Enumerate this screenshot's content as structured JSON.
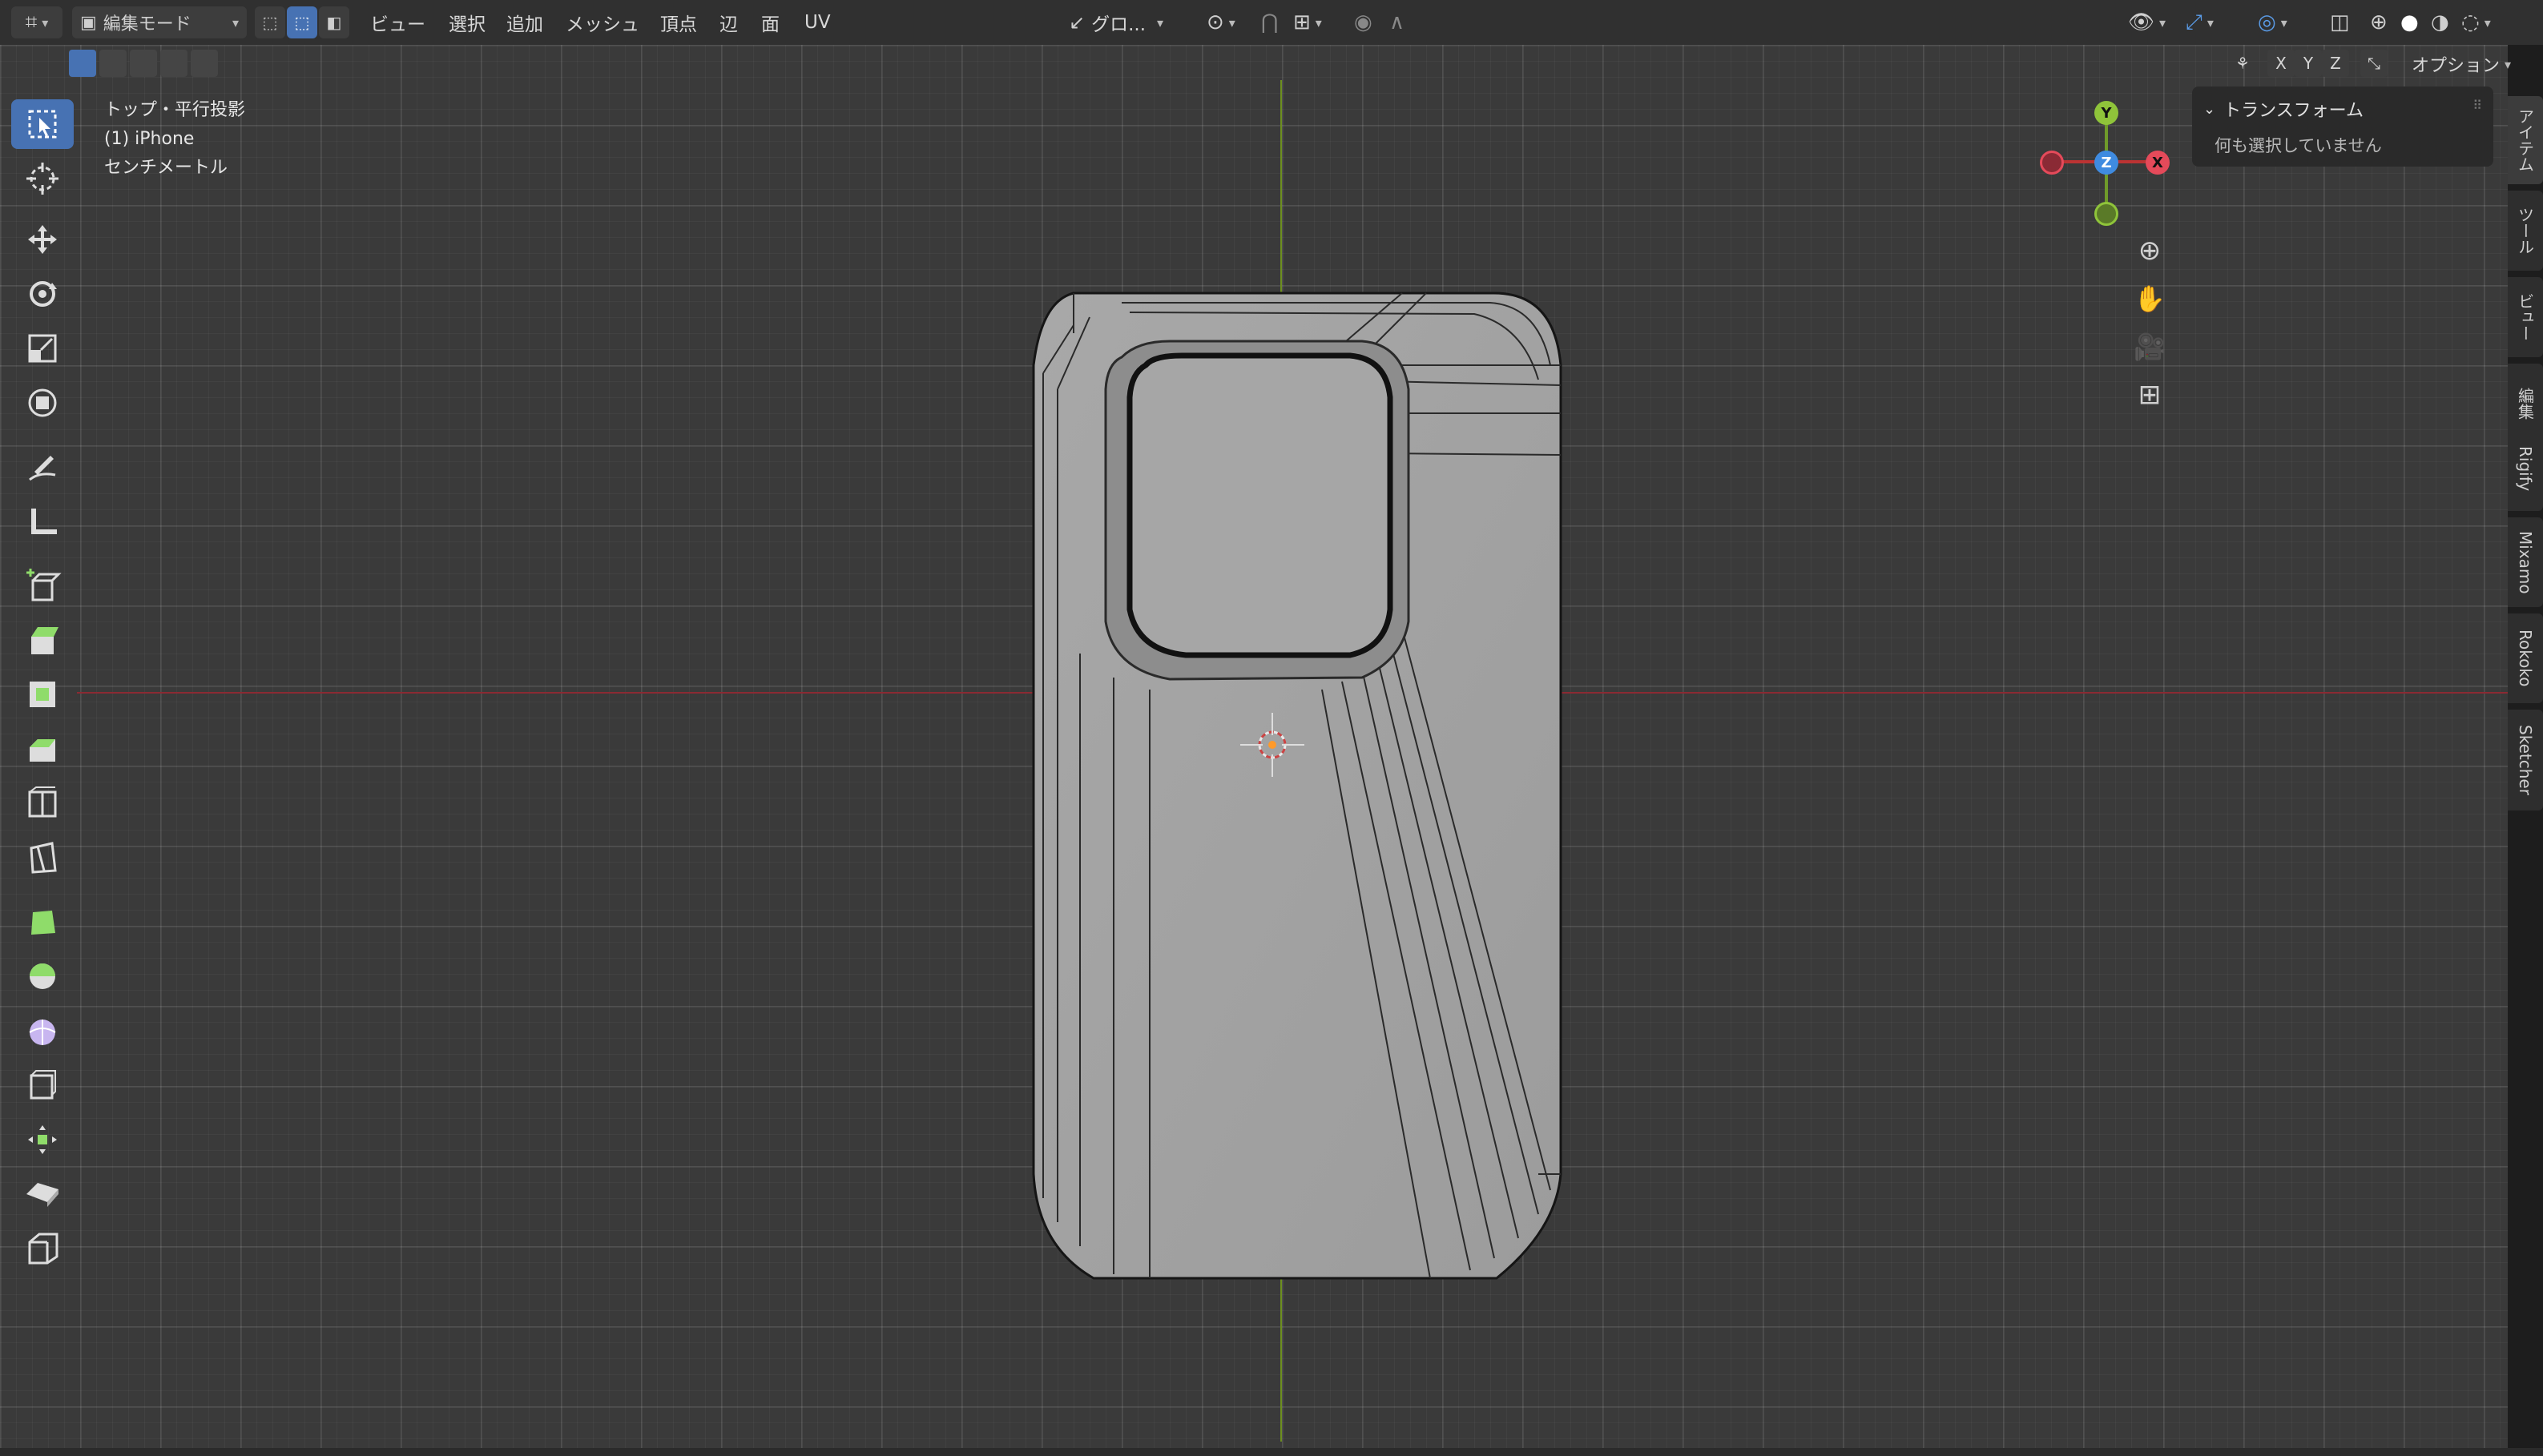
{
  "header": {
    "mode_label": "編集モード",
    "menu": [
      "ビュー",
      "選択",
      "追加",
      "メッシュ",
      "頂点",
      "辺",
      "面",
      "UV"
    ],
    "transform_orientation": "グロ...",
    "options_label": "オプション",
    "axis_x": "X",
    "axis_y": "Y",
    "axis_z": "Z"
  },
  "viewport": {
    "view_name": "トップ・平行投影",
    "object_name": "(1) iPhone",
    "units": "センチメートル"
  },
  "gizmo": {
    "x": "X",
    "y": "Y",
    "z": "Z"
  },
  "npanel": {
    "section_title": "トランスフォーム",
    "empty_message": "何も選択していません",
    "tabs": [
      "アイテム",
      "ツール",
      "ビュー",
      "編集",
      "Rigify",
      "Mixamo",
      "Rokoko",
      "Sketcher"
    ]
  },
  "toolbar": {
    "tools": [
      "select-box",
      "cursor",
      "move",
      "rotate",
      "scale",
      "transform",
      "annotate",
      "measure",
      "add-cube",
      "extrude",
      "inset",
      "bevel",
      "loop-cut",
      "knife",
      "poly-build",
      "spin",
      "smooth",
      "shrink-fatten",
      "shear",
      "rip",
      "edge-slide"
    ]
  },
  "colors": {
    "accent": "#4772b3",
    "x_axis": "#e54a5a",
    "y_axis": "#8fc43a",
    "z_axis": "#3f8be0"
  }
}
